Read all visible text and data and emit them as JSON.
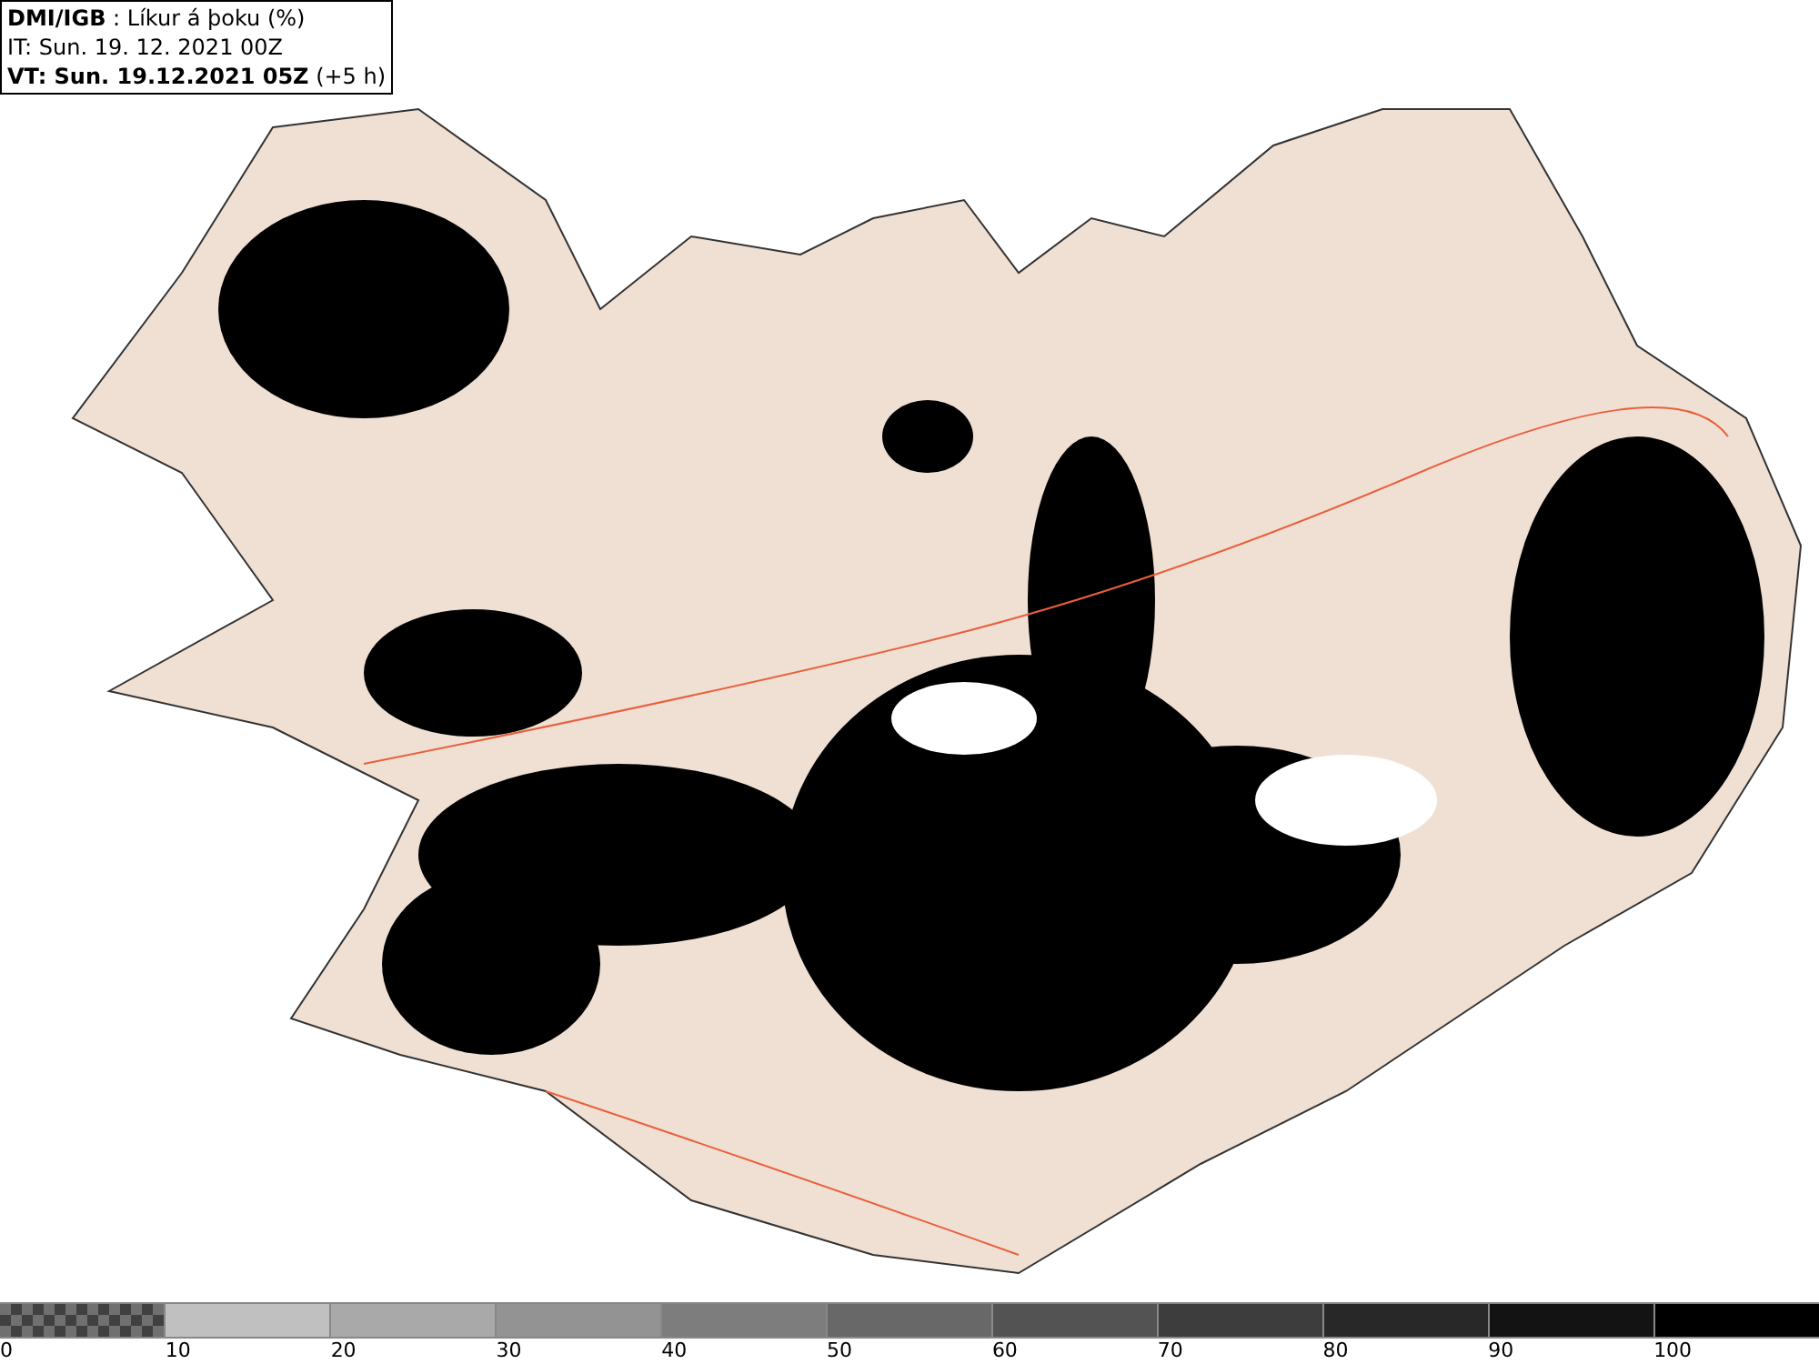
{
  "header": {
    "lines": [
      "**DMI/IGB** : Líkur á þoku (%)",
      "IT: Sun. 19. 12. 2021 00Z",
      "**VT: Sun. 19.12.2021 05Z** (+5 h)"
    ]
  },
  "legend": {
    "segments": [
      {
        "kind": "checker",
        "color": "#707070",
        "label": "0"
      },
      {
        "kind": "solid",
        "color": "#c0c0c0",
        "label": "10"
      },
      {
        "kind": "solid",
        "color": "#a9a9a9",
        "label": "20"
      },
      {
        "kind": "solid",
        "color": "#939393",
        "label": "30"
      },
      {
        "kind": "solid",
        "color": "#7d7d7d",
        "label": "40"
      },
      {
        "kind": "solid",
        "color": "#686868",
        "label": "50"
      },
      {
        "kind": "solid",
        "color": "#535353",
        "label": "60"
      },
      {
        "kind": "solid",
        "color": "#3d3d3d",
        "label": "70"
      },
      {
        "kind": "solid",
        "color": "#282828",
        "label": "80"
      },
      {
        "kind": "solid",
        "color": "#131313",
        "label": "90"
      },
      {
        "kind": "solid",
        "color": "#000000",
        "label": "100"
      }
    ]
  }
}
